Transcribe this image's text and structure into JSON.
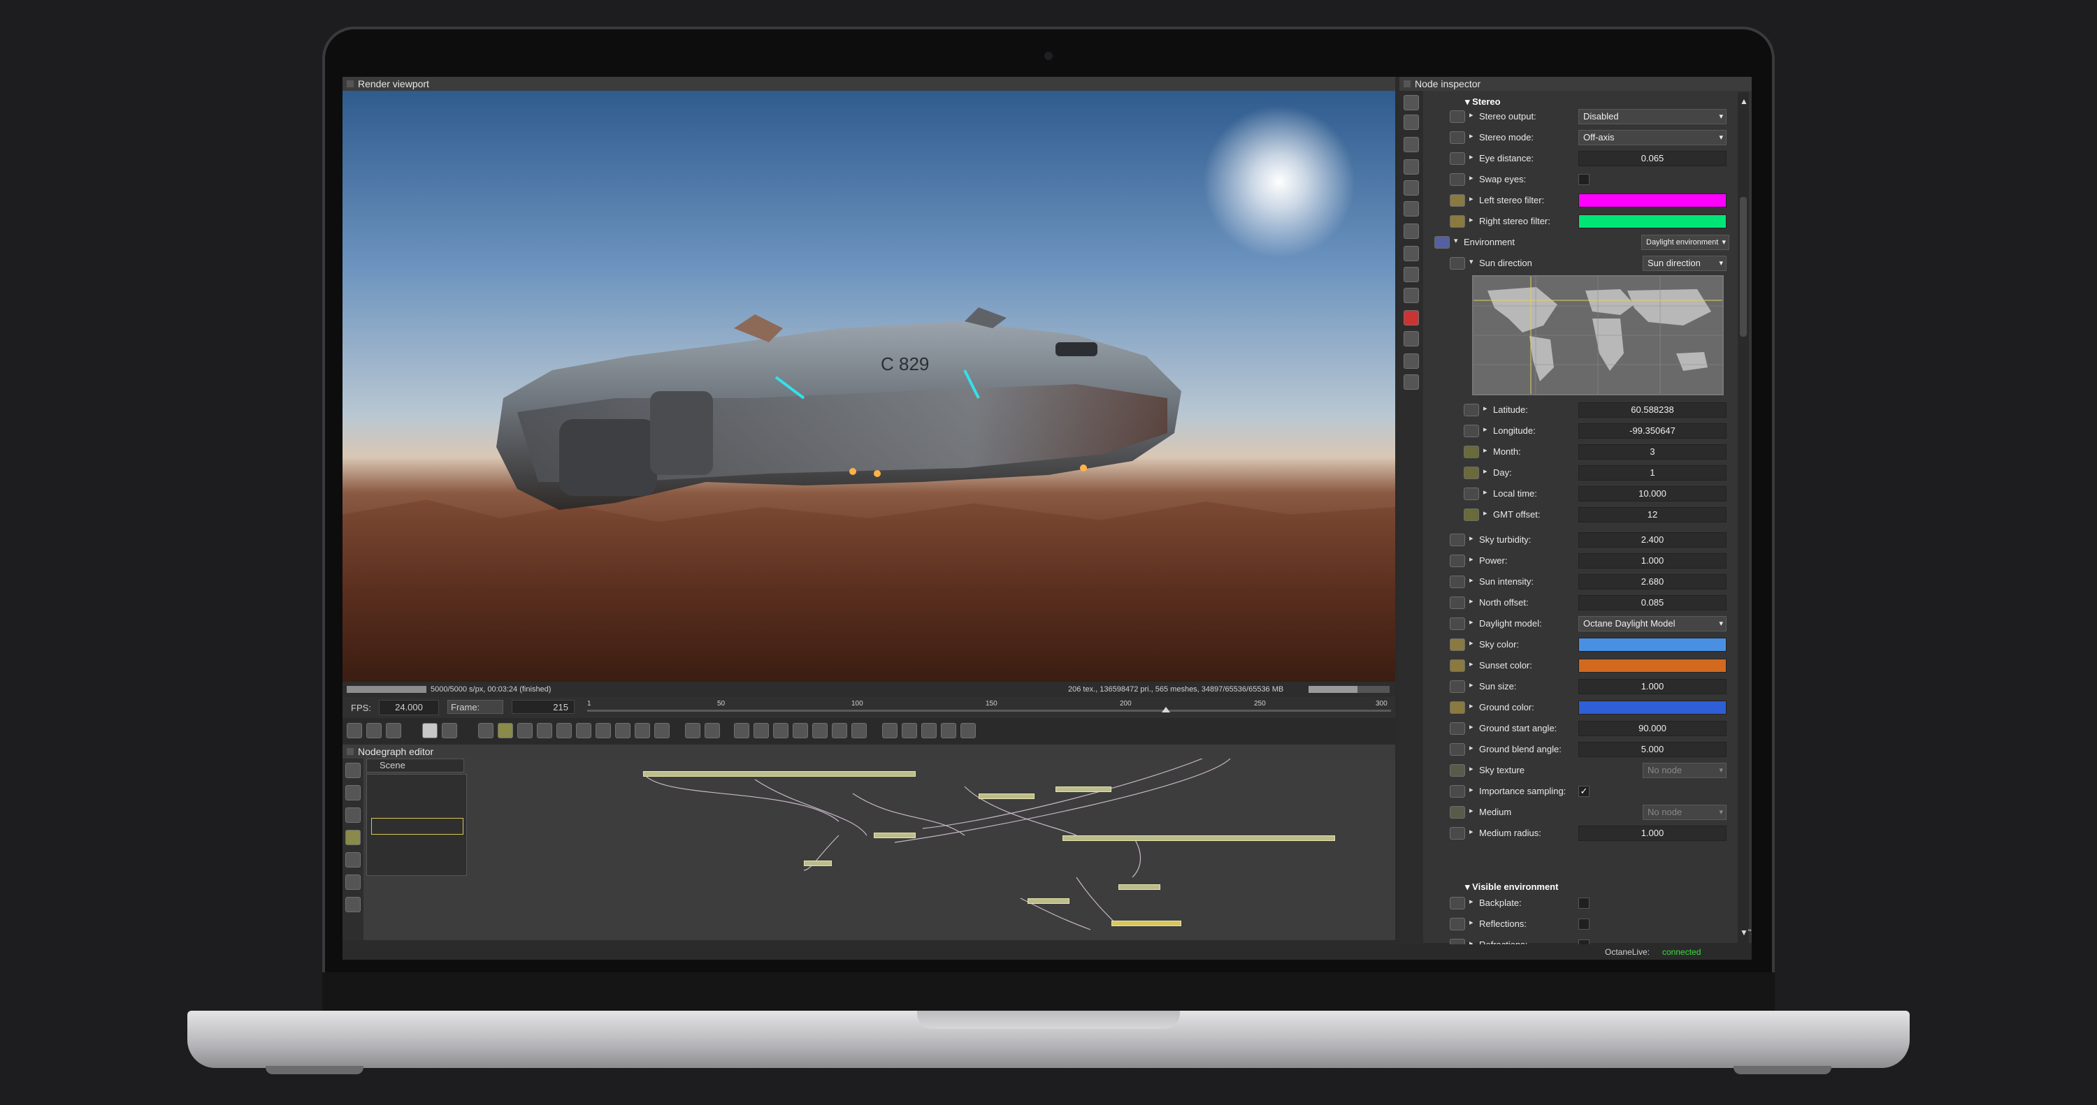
{
  "render_viewport": {
    "title": "Render viewport",
    "status_left": "5000/5000 s/px, 00:03:24 (finished)",
    "status_right": "206 tex., 136598472 pri., 565 meshes, 34897/65536/65536 MB",
    "fps_label": "FPS:",
    "fps_value": "24.000",
    "frame_label": "Frame:",
    "frame_value": "215",
    "timeline_ticks": [
      "1",
      "50",
      "100",
      "150",
      "200",
      "250",
      "300"
    ],
    "timeline_progress": 0.72
  },
  "nodegraph": {
    "title": "Nodegraph editor",
    "tab": "Scene"
  },
  "inspector": {
    "title": "Node inspector",
    "stereo": {
      "header": "Stereo",
      "rows": [
        {
          "label": "Stereo output:",
          "kind": "dropdown",
          "value": "Disabled"
        },
        {
          "label": "Stereo mode:",
          "kind": "dropdown",
          "value": "Off-axis"
        },
        {
          "label": "Eye distance:",
          "kind": "number",
          "value": "0.065"
        },
        {
          "label": "Swap eyes:",
          "kind": "checkbox",
          "value": ""
        },
        {
          "label": "Left stereo filter:",
          "kind": "color",
          "color": "#ff00ff"
        },
        {
          "label": "Right stereo filter:",
          "kind": "color",
          "color": "#00e676"
        }
      ]
    },
    "environment": {
      "header": "Environment",
      "type": "Daylight environment",
      "sun_direction": {
        "label": "Sun direction",
        "value": "Sun direction"
      },
      "sun_rows": [
        {
          "label": "Latitude:",
          "value": "60.588238"
        },
        {
          "label": "Longitude:",
          "value": "-99.350647"
        },
        {
          "label": "Month:",
          "value": "3"
        },
        {
          "label": "Day:",
          "value": "1"
        },
        {
          "label": "Local time:",
          "value": "10.000"
        },
        {
          "label": "GMT offset:",
          "value": "12"
        }
      ],
      "rows": [
        {
          "label": "Sky turbidity:",
          "kind": "number",
          "value": "2.400"
        },
        {
          "label": "Power:",
          "kind": "number",
          "value": "1.000"
        },
        {
          "label": "Sun intensity:",
          "kind": "number",
          "value": "2.680"
        },
        {
          "label": "North offset:",
          "kind": "number",
          "value": "0.085"
        },
        {
          "label": "Daylight model:",
          "kind": "dropdown",
          "value": "Octane Daylight Model"
        },
        {
          "label": "Sky color:",
          "kind": "color",
          "color": "#4a90e2"
        },
        {
          "label": "Sunset color:",
          "kind": "color",
          "color": "#d2691e"
        },
        {
          "label": "Sun size:",
          "kind": "number",
          "value": "1.000"
        },
        {
          "label": "Ground color:",
          "kind": "color",
          "color": "#2e5fd6"
        },
        {
          "label": "Ground start angle:",
          "kind": "number",
          "value": "90.000"
        },
        {
          "label": "Ground blend angle:",
          "kind": "number",
          "value": "5.000"
        },
        {
          "label": "Sky texture",
          "kind": "dropdown",
          "value": "No node"
        },
        {
          "label": "Importance sampling:",
          "kind": "checkbox",
          "value": "✓"
        },
        {
          "label": "Medium",
          "kind": "dropdown",
          "value": "No node"
        },
        {
          "label": "Medium radius:",
          "kind": "number",
          "value": "1.000"
        }
      ]
    },
    "visible_environment": {
      "header": "Visible environment",
      "rows": [
        {
          "label": "Backplate:"
        },
        {
          "label": "Reflections:"
        },
        {
          "label": "Refractions:"
        }
      ]
    },
    "status_label": "OctaneLive:",
    "status_value": "connected",
    "status_color": "#3ddc3d"
  }
}
